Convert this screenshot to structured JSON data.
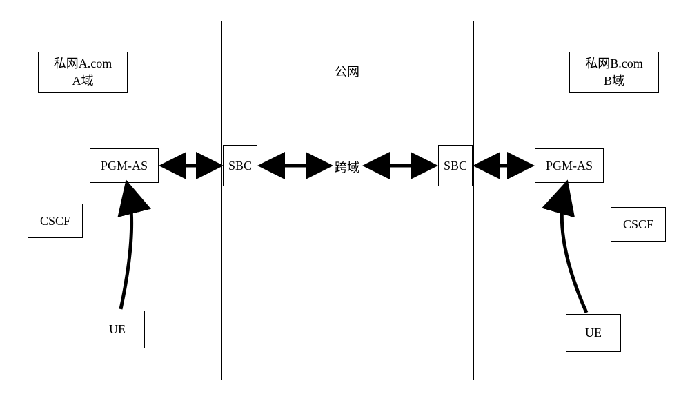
{
  "regions": {
    "left_network": {
      "line1": "私网A.com",
      "line2": "A域"
    },
    "public_network": "公网",
    "right_network": {
      "line1": "私网B.com",
      "line2": "B域"
    }
  },
  "nodes": {
    "left_pgm_as": "PGM-AS",
    "left_sbc": "SBC",
    "right_sbc": "SBC",
    "right_pgm_as": "PGM-AS",
    "left_cscf": "CSCF",
    "right_cscf": "CSCF",
    "left_ue": "UE",
    "right_ue": "UE"
  },
  "edges": {
    "cross_domain": "跨域"
  }
}
